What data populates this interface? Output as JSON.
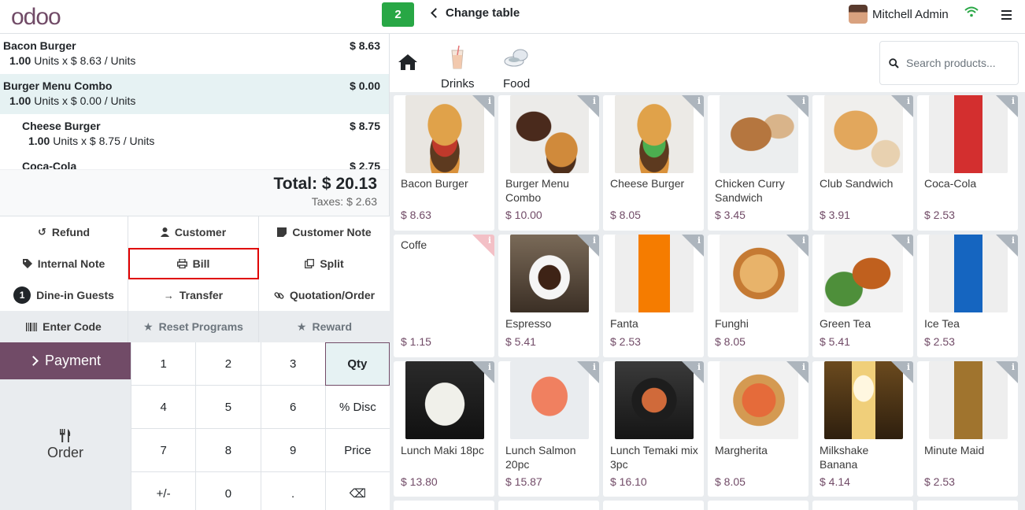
{
  "header": {
    "logo": "odoo",
    "table_number": "2",
    "change_table": "Change table",
    "user_name": "Mitchell Admin"
  },
  "order": {
    "lines": [
      {
        "name": "Bacon Burger",
        "price": "$ 8.63",
        "qty": "1.00",
        "detail": "Units x $ 8.63 / Units"
      },
      {
        "name": "Burger Menu Combo",
        "price": "$ 0.00",
        "qty": "1.00",
        "detail": "Units x $ 0.00 / Units"
      },
      {
        "name": "Cheese Burger",
        "price": "$ 8.75",
        "qty": "1.00",
        "detail": "Units x $ 8.75 / Units"
      },
      {
        "name": "Coca-Cola",
        "price": "$ 2.75",
        "qty": "",
        "detail": ""
      }
    ],
    "total": "Total: $ 20.13",
    "taxes": "Taxes: $ 2.63"
  },
  "controls": {
    "refund": "Refund",
    "customer": "Customer",
    "customer_note": "Customer Note",
    "internal_note": "Internal Note",
    "bill": "Bill",
    "split": "Split",
    "guests_count": "1",
    "dine_in_guests": "Dine-in Guests",
    "transfer": "Transfer",
    "quotation_order": "Quotation/Order",
    "enter_code": "Enter Code",
    "reset_programs": "Reset Programs",
    "reward": "Reward"
  },
  "payment": {
    "payment_label": "Payment",
    "order_label": "Order",
    "keys": [
      "1",
      "2",
      "3",
      "Qty",
      "4",
      "5",
      "6",
      "% Disc",
      "7",
      "8",
      "9",
      "Price",
      "+/-",
      "0",
      ".",
      "⌫"
    ]
  },
  "categories": [
    {
      "label": "Drinks",
      "icon": "drink-icon"
    },
    {
      "label": "Food",
      "icon": "food-icon"
    }
  ],
  "search": {
    "placeholder": "Search products..."
  },
  "products": [
    {
      "name": "Bacon Burger",
      "price": "$ 8.63"
    },
    {
      "name": "Burger Menu Combo",
      "price": "$ 10.00"
    },
    {
      "name": "Cheese Burger",
      "price": "$ 8.05"
    },
    {
      "name": "Chicken Curry Sandwich",
      "price": "$ 3.45"
    },
    {
      "name": "Club Sandwich",
      "price": "$ 3.91"
    },
    {
      "name": "Coca-Cola",
      "price": "$ 2.53"
    },
    {
      "name": "Coffe",
      "price": "$ 1.15"
    },
    {
      "name": "Espresso",
      "price": "$ 5.41"
    },
    {
      "name": "Fanta",
      "price": "$ 2.53"
    },
    {
      "name": "Funghi",
      "price": "$ 8.05"
    },
    {
      "name": "Green Tea",
      "price": "$ 5.41"
    },
    {
      "name": "Ice Tea",
      "price": "$ 2.53"
    },
    {
      "name": "Lunch Maki 18pc",
      "price": "$ 13.80"
    },
    {
      "name": "Lunch Salmon 20pc",
      "price": "$ 15.87"
    },
    {
      "name": "Lunch Temaki mix 3pc",
      "price": "$ 16.10"
    },
    {
      "name": "Margherita",
      "price": "$ 8.05"
    },
    {
      "name": "Milkshake Banana",
      "price": "$ 4.14"
    },
    {
      "name": "Minute Maid",
      "price": "$ 2.53"
    }
  ],
  "colors": {
    "brand": "#714b67",
    "table_badge": "#28a745",
    "selected_line": "#e6f2f3",
    "highlight": "#e00000"
  }
}
